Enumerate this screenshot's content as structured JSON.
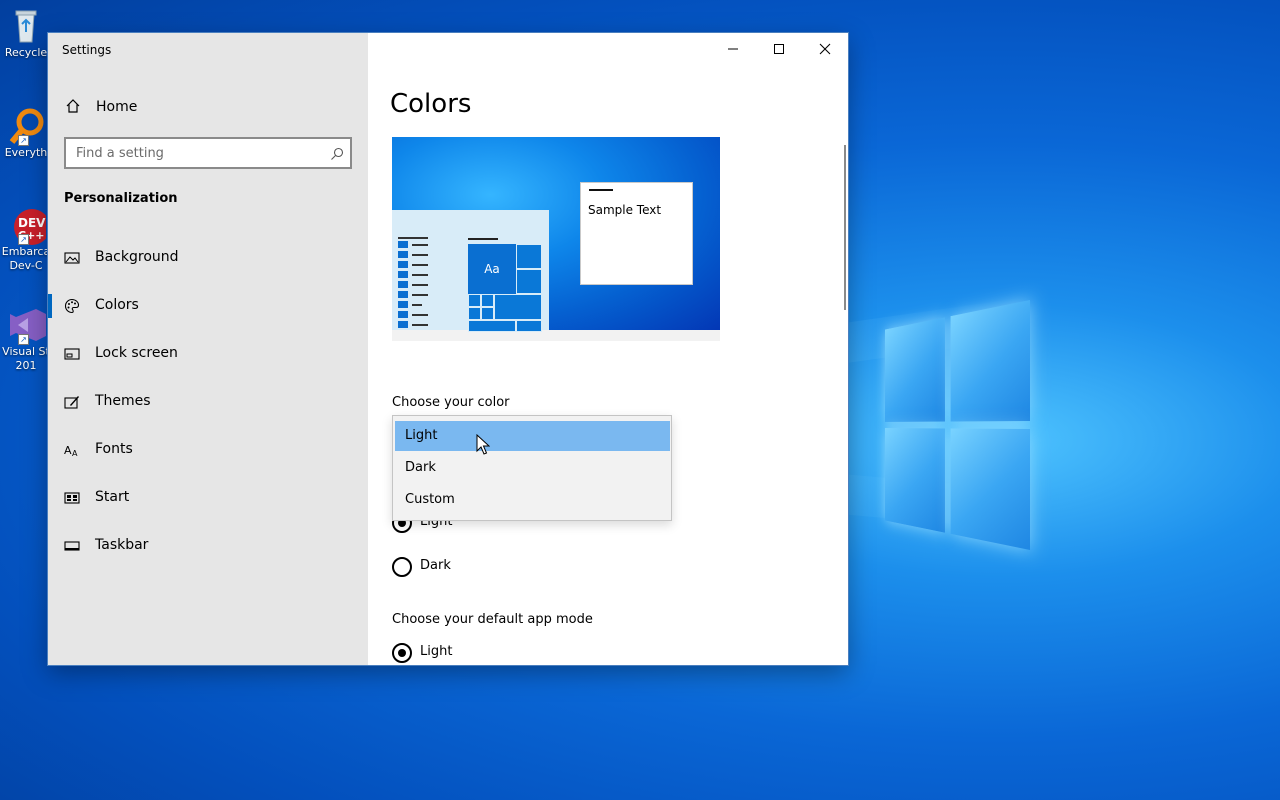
{
  "desktop": {
    "icons": [
      {
        "label": "Recycle",
        "icon": "recycle-bin-icon"
      },
      {
        "label": "Everyth",
        "icon": "everything-search-icon"
      },
      {
        "label": "Embarca",
        "label2": "Dev-C",
        "icon": "dev-cpp-icon"
      },
      {
        "label": "Visual St",
        "label2": "201",
        "icon": "visual-studio-icon"
      }
    ]
  },
  "window": {
    "title": "Settings",
    "accent": "#0067c0"
  },
  "sidebar": {
    "home_label": "Home",
    "search_placeholder": "Find a setting",
    "section_title": "Personalization",
    "items": [
      {
        "label": "Background",
        "icon": "picture-icon"
      },
      {
        "label": "Colors",
        "icon": "palette-icon",
        "selected": true
      },
      {
        "label": "Lock screen",
        "icon": "lock-screen-icon"
      },
      {
        "label": "Themes",
        "icon": "themes-icon"
      },
      {
        "label": "Fonts",
        "icon": "fonts-icon"
      },
      {
        "label": "Start",
        "icon": "start-icon"
      },
      {
        "label": "Taskbar",
        "icon": "taskbar-icon"
      }
    ]
  },
  "main": {
    "title": "Colors",
    "preview": {
      "sample_text": "Sample Text",
      "tile_text": "Aa"
    },
    "choose_color_label": "Choose your color",
    "color_dropdown": {
      "options": [
        "Light",
        "Dark",
        "Custom"
      ],
      "hovered": "Light"
    },
    "windows_mode": {
      "options": [
        "Light",
        "Dark"
      ],
      "selected": "Light"
    },
    "app_mode_label": "Choose your default app mode",
    "app_mode": {
      "options": [
        "Light"
      ],
      "selected": "Light"
    }
  }
}
